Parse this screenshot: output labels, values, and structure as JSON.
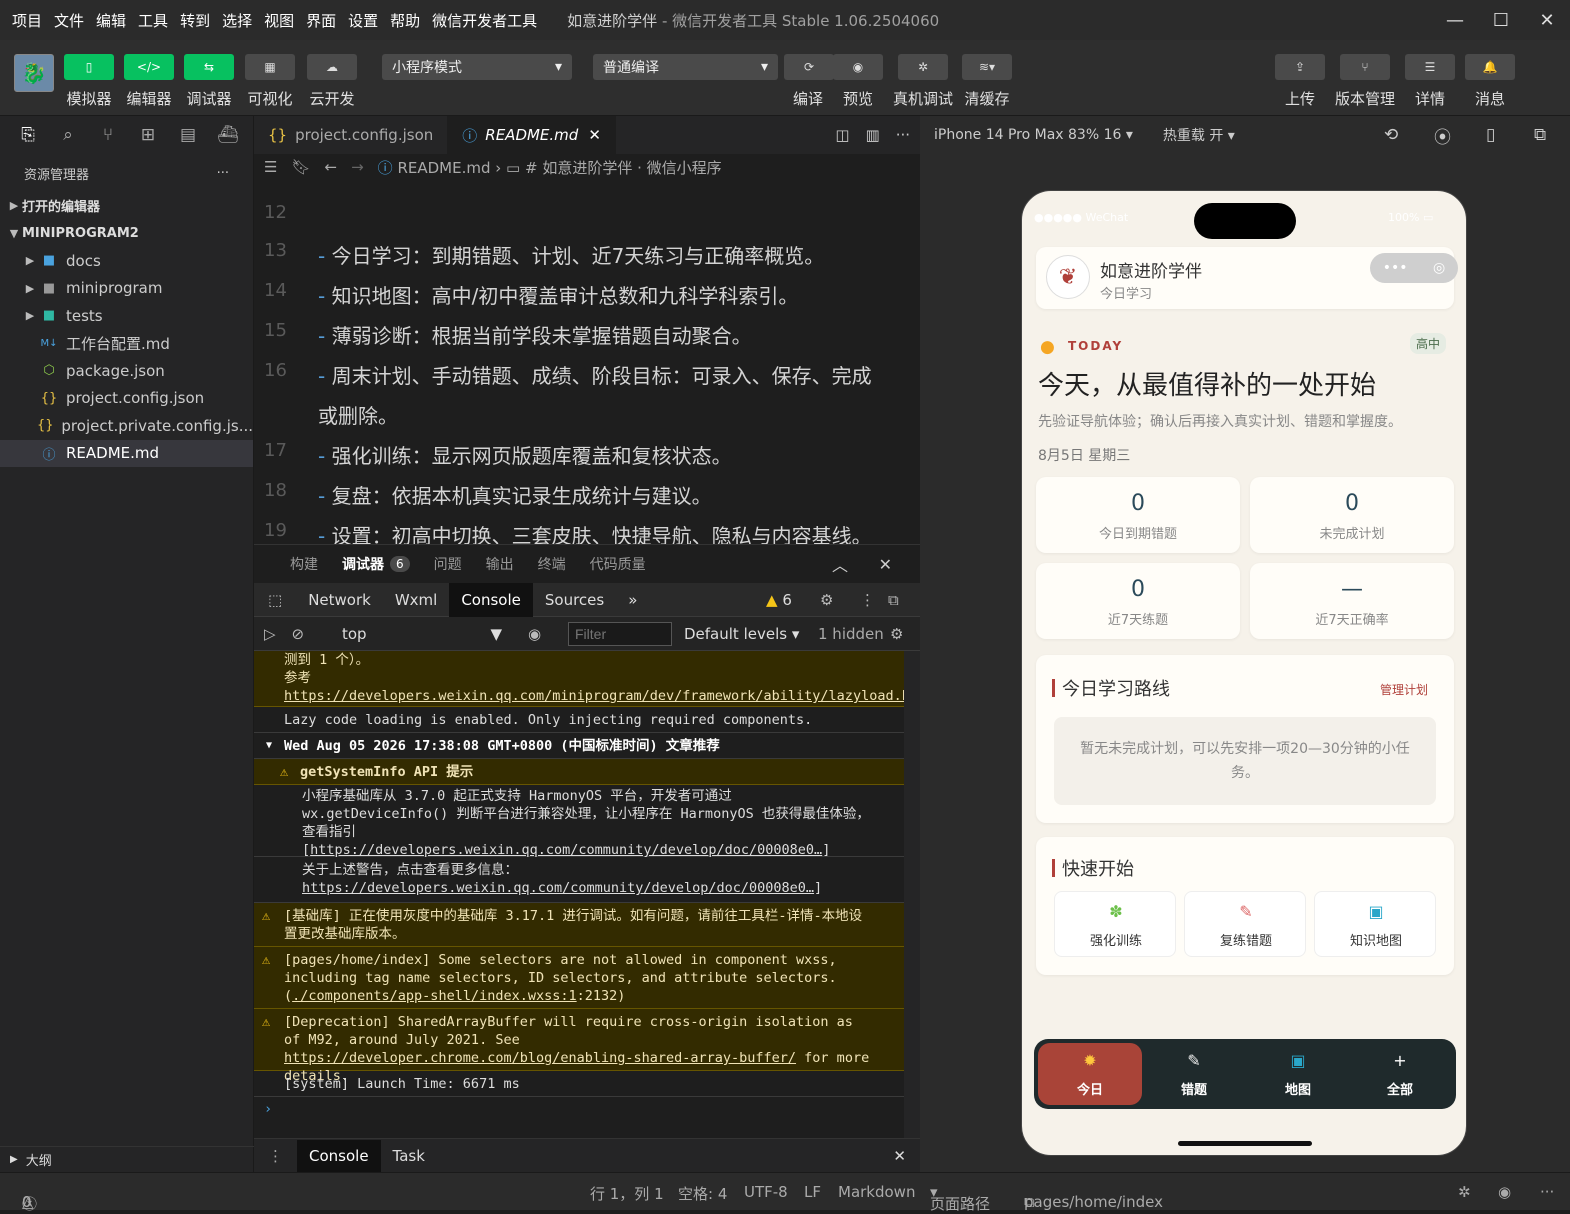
{
  "window": {
    "menu": [
      "项目",
      "文件",
      "编辑",
      "工具",
      "转到",
      "选择",
      "视图",
      "界面",
      "设置",
      "帮助",
      "微信开发者工具"
    ],
    "title": "如意进阶学伴",
    "title_suffix": " - 微信开发者工具 Stable 1.06.2504060"
  },
  "toolbar": {
    "simulator": "模拟器",
    "editor": "编辑器",
    "debugger": "调试器",
    "visual": "可视化",
    "cloud": "云开发",
    "mode": "小程序模式",
    "compile_mode": "普通编译",
    "compile": "编译",
    "preview": "预览",
    "remote_debug": "真机调试",
    "clear_cache": "清缓存",
    "upload": "上传",
    "version": "版本管理",
    "details": "详情",
    "messages": "消息"
  },
  "sidebar": {
    "title": "资源管理器",
    "open_editors": "打开的编辑器",
    "project": "MINIPROGRAM2",
    "items": [
      {
        "label": "docs",
        "icon": "folder-blue-icon"
      },
      {
        "label": "miniprogram",
        "icon": "folder-icon"
      },
      {
        "label": "tests",
        "icon": "folder-teal-icon"
      },
      {
        "label": "工作台配置.md",
        "icon": "markdown-icon"
      },
      {
        "label": "package.json",
        "icon": "node-icon"
      },
      {
        "label": "project.config.json",
        "icon": "json-icon"
      },
      {
        "label": "project.private.config.js...",
        "icon": "json-icon"
      },
      {
        "label": "README.md",
        "icon": "info-icon"
      }
    ],
    "outline": "大纲"
  },
  "editor": {
    "tabs": [
      "project.config.json",
      "README.md"
    ],
    "breadcrumb": [
      "README.md",
      "# 如意进阶学伴 · 微信小程序"
    ],
    "lines": [
      {
        "n": "12",
        "t": ""
      },
      {
        "n": "13",
        "t": "今日学习：到期错题、计划、近7天练习与正确率概览。"
      },
      {
        "n": "14",
        "t": "知识地图：高中/初中覆盖审计总数和九科学科索引。"
      },
      {
        "n": "15",
        "t": "薄弱诊断：根据当前学段未掌握错题自动聚合。"
      },
      {
        "n": "16",
        "t": "周末计划、手动错题、成绩、阶段目标：可录入、保存、完成"
      },
      {
        "n": "",
        "t": "或删除。"
      },
      {
        "n": "17",
        "t": "强化训练：显示网页版题库覆盖和复核状态。"
      },
      {
        "n": "18",
        "t": "复盘：依据本机真实记录生成统计与建议。"
      },
      {
        "n": "19",
        "t": "设置：初高中切换、三套皮肤、快捷导航、隐私与内容基线。"
      }
    ]
  },
  "panel": {
    "tabs": [
      "构建",
      "调试器",
      "问题",
      "输出",
      "终端",
      "代码质量"
    ],
    "debugger_count": "6",
    "devtools_tabs": [
      "Network",
      "Wxml",
      "Console",
      "Sources"
    ],
    "warn_count": "6",
    "context": "top",
    "filter_placeholder": "Filter",
    "levels": "Default levels",
    "hidden": "1 hidden",
    "bottom_tabs": [
      "Console",
      "Task"
    ],
    "console": {
      "m1a": "测到 1 个）。",
      "m1b": "参考 ",
      "m1link": "https://developers.weixin.qq.com/miniprogram/dev/framework/ability/lazyload.html",
      "m2": "Lazy code loading is enabled. Only injecting required components.",
      "m3": "Wed Aug 05 2026 17:38:08 GMT+0800 (中国标准时间) 文章推荐",
      "m4": "getSystemInfo API 提示",
      "m5": "小程序基础库从 3.7.0 起正式支持 HarmonyOS 平台，开发者可通过 wx.getDeviceInfo() 判断平台进行兼容处理，让小程序在 HarmonyOS 也获得最佳体验，查看指引[",
      "m5link": "https://developers.weixin.qq.com/community/develop/doc/00008e0…",
      "m5end": "]",
      "m6": "关于上述警告，点击查看更多信息：",
      "m6link": "https://developers.weixin.qq.com/community/develop/doc/00008e0…",
      "m6end": "]",
      "m7": "[基础库] 正在使用灰度中的基础库 3.17.1 进行调试。如有问题，请前往工具栏-详情-本地设置更改基础库版本。",
      "m8": "[pages/home/index] Some selectors are not allowed in component wxss, including tag name selectors, ID selectors, and attribute selectors.(",
      "m8link": "./components/app-shell/index.wxss:1",
      "m8end": ":2132)",
      "m9": "[Deprecation] SharedArrayBuffer will require cross-origin isolation as of M92, around July 2021. See ",
      "m9link": "https://developer.chrome.com/blog/enabling-shared-array-buffer/",
      "m9end": " for more details.",
      "m10": "[system] Launch Time: 6671 ms"
    }
  },
  "status": {
    "errors": "0",
    "warnings": "0",
    "position": "行 1，列 1",
    "spaces": "空格: 4",
    "encoding": "UTF-8",
    "eol": "LF",
    "language": "Markdown",
    "page_path_label": "页面路径",
    "page_path": "pages/home/index"
  },
  "simulator": {
    "device": "iPhone 14 Pro Max 83% 16",
    "hot_reload": "热重载 开"
  },
  "app": {
    "status_left": "●●●●● WeChat",
    "status_right": "100%",
    "name": "如意进阶学伴",
    "subtitle": "今日学习",
    "today_label": "TODAY",
    "level_badge": "高中",
    "headline": "今天，从最值得补的一处开始",
    "desc": "先验证导航体验；确认后再接入真实计划、错题和掌握度。",
    "date": "8月5日 星期三",
    "stats": [
      {
        "value": "0",
        "label": "今日到期错题"
      },
      {
        "value": "0",
        "label": "未完成计划"
      },
      {
        "value": "0",
        "label": "近7天练题"
      },
      {
        "value": "—",
        "label": "近7天正确率"
      }
    ],
    "route_title": "今日学习路线",
    "manage": "管理计划",
    "route_empty": "暂无未完成计划，可以先安排一项20—30分钟的小任务。",
    "quick_title": "快速开始",
    "quick": [
      {
        "label": "强化训练",
        "icon": "puzzle-icon"
      },
      {
        "label": "复练错题",
        "icon": "memo-icon"
      },
      {
        "label": "知识地图",
        "icon": "book-icon"
      }
    ],
    "nav": [
      {
        "label": "今日",
        "icon": "sun-icon"
      },
      {
        "label": "错题",
        "icon": "memo-icon"
      },
      {
        "label": "地图",
        "icon": "book-icon"
      },
      {
        "label": "全部",
        "icon": "plus-icon"
      }
    ],
    "colors": {
      "accent": "#b0403a",
      "tab_active": "#a94438",
      "nav_bg": "#1f2a2c",
      "bg": "#f6f2ea"
    }
  }
}
